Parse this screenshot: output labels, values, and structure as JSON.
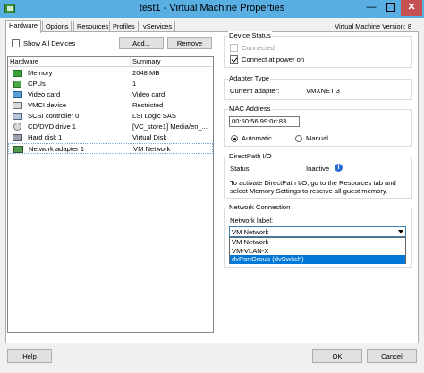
{
  "window": {
    "title": "test1 - Virtual Machine Properties",
    "min_glyph": "—",
    "close_glyph": "✕"
  },
  "tabs": [
    {
      "label": "Hardware"
    },
    {
      "label": "Options"
    },
    {
      "label": "Resources"
    },
    {
      "label": "Profiles"
    },
    {
      "label": "vServices"
    }
  ],
  "version_label": "Virtual Machine Version: 8",
  "left": {
    "show_all_devices": {
      "label": "Show All Devices",
      "checked": false
    },
    "add_label": "Add...",
    "remove_label": "Remove",
    "columns": [
      "Hardware",
      "Summary"
    ],
    "rows": [
      {
        "name": "Memory",
        "summary": "2048 MB",
        "icon": "memory-icon"
      },
      {
        "name": "CPUs",
        "summary": "1",
        "icon": "cpu-icon"
      },
      {
        "name": "Video card",
        "summary": "Video card",
        "icon": "video-card-icon"
      },
      {
        "name": "VMCI device",
        "summary": "Restricted",
        "icon": "vmci-device-icon"
      },
      {
        "name": "SCSI controller 0",
        "summary": "LSI Logic SAS",
        "icon": "scsi-controller-icon"
      },
      {
        "name": "CD/DVD drive 1",
        "summary": "[VC_store1] Media/en_...",
        "icon": "cd-dvd-icon"
      },
      {
        "name": "Hard disk 1",
        "summary": "Virtual Disk",
        "icon": "hard-disk-icon"
      },
      {
        "name": "Network adapter 1",
        "summary": "VM Network",
        "icon": "network-adapter-icon",
        "selected": true
      }
    ]
  },
  "right": {
    "device_status": {
      "title": "Device Status",
      "connected_label": "Connected",
      "connected_checked": false,
      "power_on_label": "Connect at power on",
      "power_on_checked": true
    },
    "adapter_type": {
      "title": "Adapter Type",
      "label": "Current adapter:",
      "value": "VMXNET 3"
    },
    "mac_address": {
      "title": "MAC Address",
      "value": "00:50:56:99:0d:83",
      "automatic_label": "Automatic",
      "manual_label": "Manual",
      "selected": "Automatic"
    },
    "directpath": {
      "title": "DirectPath I/O",
      "status_label": "Status:",
      "status_value": "Inactive",
      "info_icon": "info-icon",
      "info_glyph": "i",
      "note_line1": "To activate DirectPath I/O, go to the Resources tab and",
      "note_line2": "select Memory Settings to reserve all guest memory."
    },
    "network_connection": {
      "title": "Network Connection",
      "label": "Network label:",
      "selected": "VM Network",
      "options": [
        "VM Network",
        "VM-VLAN-X",
        "dvPortGroup (dvSwitch)"
      ],
      "highlighted_option": "dvPortGroup (dvSwitch)"
    }
  },
  "footer": {
    "help_label": "Help",
    "ok_label": "OK",
    "cancel_label": "Cancel"
  },
  "colors": {
    "titlebar": "#59aee2",
    "close": "#c75050",
    "selection": "#0078d7"
  }
}
